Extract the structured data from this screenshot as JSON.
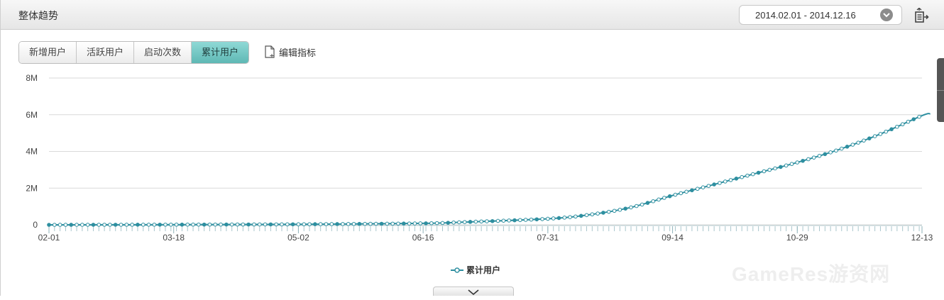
{
  "header": {
    "title": "整体趋势",
    "date_range": "2014.02.01 - 2014.12.16"
  },
  "tabs": [
    {
      "label": "新增用户",
      "active": false
    },
    {
      "label": "活跃用户",
      "active": false
    },
    {
      "label": "启动次数",
      "active": false
    },
    {
      "label": "累计用户",
      "active": true
    }
  ],
  "edit_metric_label": "编辑指标",
  "watermark": "GameRes游资网",
  "colors": {
    "series": "#2e8fa0",
    "grid": "#d9d9d9",
    "active_tab": "#6cc4c0"
  },
  "chart_data": {
    "type": "line",
    "x_start": "2014-02-01",
    "x_end": "2014-12-13",
    "x_tick_labels": [
      "02-01",
      "03-18",
      "05-02",
      "06-16",
      "07-31",
      "09-14",
      "10-29",
      "12-13"
    ],
    "y_tick_labels": [
      "0",
      "2M",
      "4M",
      "6M",
      "8M"
    ],
    "ylim": [
      0,
      8000000
    ],
    "grid": true,
    "legend_position": "bottom",
    "series": [
      {
        "name": "累计用户",
        "points": [
          [
            "2014-02-01",
            0
          ],
          [
            "2014-03-18",
            10000
          ],
          [
            "2014-05-02",
            30000
          ],
          [
            "2014-06-16",
            80000
          ],
          [
            "2014-07-01",
            150000
          ],
          [
            "2014-07-31",
            330000
          ],
          [
            "2014-08-15",
            550000
          ],
          [
            "2014-08-30",
            950000
          ],
          [
            "2014-09-14",
            1600000
          ],
          [
            "2014-09-29",
            2200000
          ],
          [
            "2014-10-14",
            2800000
          ],
          [
            "2014-10-29",
            3400000
          ],
          [
            "2014-11-13",
            4100000
          ],
          [
            "2014-11-28",
            4950000
          ],
          [
            "2014-12-13",
            5950000
          ],
          [
            "2014-12-16",
            6050000
          ]
        ]
      }
    ]
  }
}
